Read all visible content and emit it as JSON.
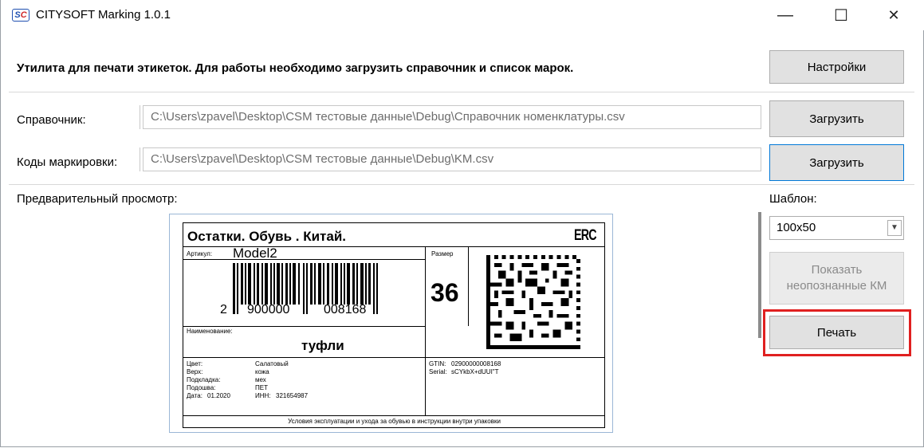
{
  "window": {
    "title": "CITYSOFT Marking 1.0.1",
    "icon_left": "SC",
    "min_glyph": "—",
    "max_glyph": "☐",
    "close_glyph": "✕"
  },
  "header": {
    "text": "Утилита для печати этикеток. Для работы необходимо загрузить справочник и список марок.",
    "settings_label": "Настройки"
  },
  "reference": {
    "label": "Справочник:",
    "path": "C:\\Users\\zpavel\\Desktop\\CSM тестовые данные\\Debug\\Справочник номенклатуры.csv",
    "load_label": "Загрузить"
  },
  "codes": {
    "label": "Коды маркировки:",
    "path": "C:\\Users\\zpavel\\Desktop\\CSM тестовые данные\\Debug\\KM.csv",
    "load_label": "Загрузить"
  },
  "preview": {
    "label": "Предварительный просмотр:"
  },
  "template": {
    "label": "Шаблон:",
    "selected": "100x50",
    "show_unrecognized_line1": "Показать",
    "show_unrecognized_line2": "неопознанные КМ",
    "print_label": "Печать"
  },
  "tag": {
    "title": "Остатки. Обувь . Китай.",
    "eac": "ERC",
    "article_label": "Артикул:",
    "article": "Model2",
    "size_label": "Размер",
    "size": "36",
    "barcode_left": "2",
    "barcode_mid": "900000",
    "barcode_right": "008168",
    "name_label": "Наименование:",
    "name": "туфли",
    "color_label": "Цвет:",
    "color": "Салатовый",
    "top_label": "Верх:",
    "top": "кожа",
    "lining_label": "Подкладка:",
    "lining": "мех",
    "sole_label": "Подошва:",
    "sole": "ПЕТ",
    "date_label": "Дата:",
    "date": "01.2020",
    "inn_label": "ИНН:",
    "inn": "321654987",
    "gtin_label": "GTIN:",
    "gtin": "02900000008168",
    "serial_label": "Serial:",
    "serial": "sCYkbX+dUUI\"T",
    "footer": "Условия эксплуатации и ухода за обувью в инструкции внутри упаковки"
  }
}
